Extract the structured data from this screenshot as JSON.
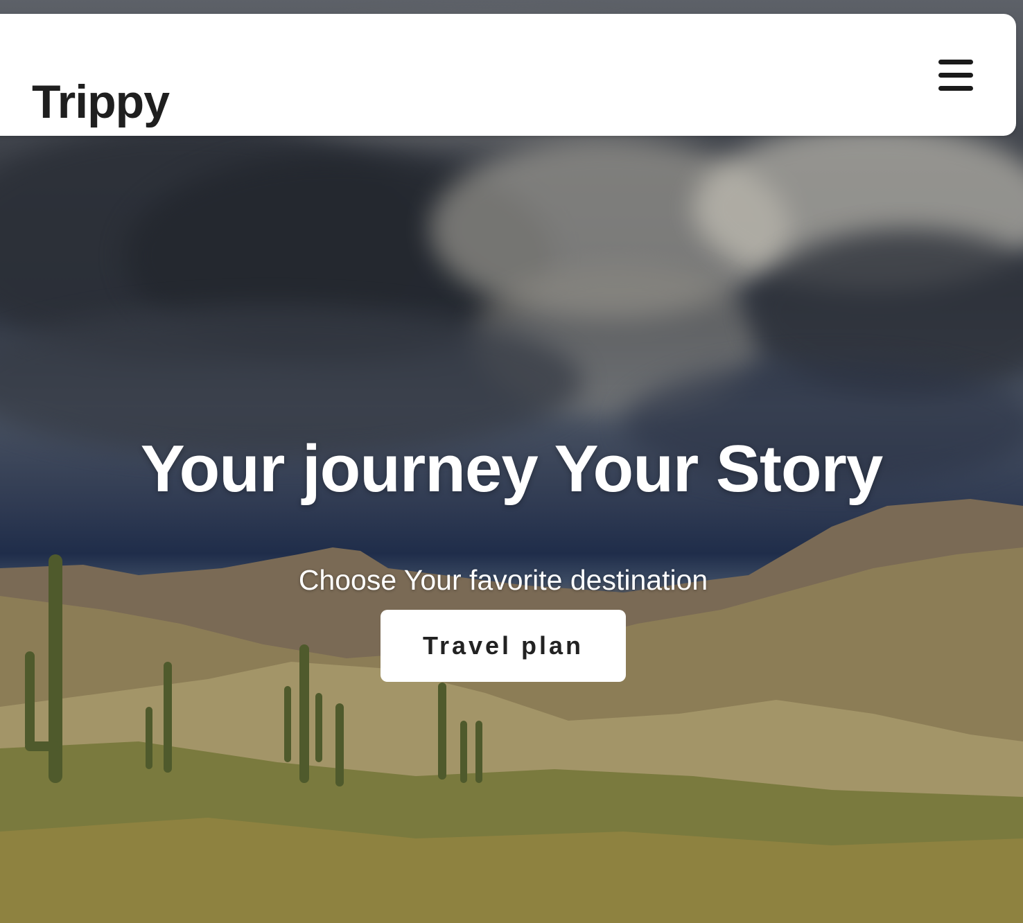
{
  "navbar": {
    "brand": "Trippy",
    "menu_icon": "hamburger-menu-icon"
  },
  "hero": {
    "headline": "Your journey Your Story",
    "subtitle": "Choose Your favorite destination",
    "cta_label": "Travel plan",
    "background": "desert-landscape-storm-clouds-image"
  },
  "colors": {
    "navbar_bg": "#ffffff",
    "brand_text": "#1f1f1f",
    "headline_text": "#ffffff",
    "button_bg": "#ffffff",
    "button_text": "#222222"
  }
}
